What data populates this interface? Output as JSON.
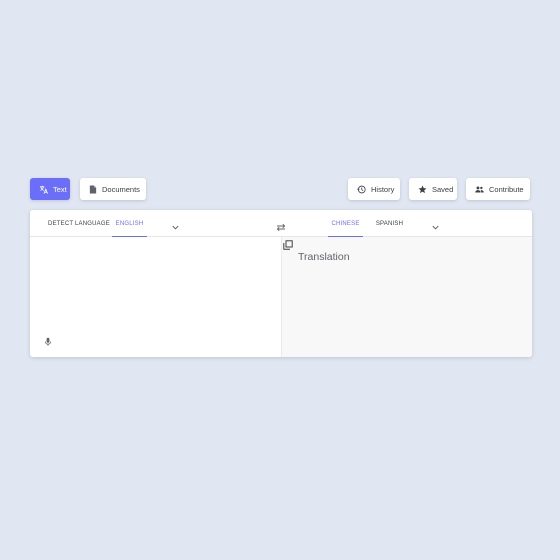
{
  "toolbar": {
    "text_label": "Text",
    "documents_label": "Documents",
    "history_label": "History",
    "saved_label": "Saved",
    "contribute_label": "Contribute"
  },
  "source": {
    "languages": [
      "DETECT LANGUAGE",
      "ENGLISH"
    ],
    "selected": "ENGLISH"
  },
  "target": {
    "languages": [
      "CHINESE",
      "SPANISH"
    ],
    "selected": "CHINESE",
    "placeholder": "Translation"
  },
  "colors": {
    "accent": "#6b6ef9",
    "background": "#e1e6f3",
    "output_pane": "#f8f8f9"
  },
  "icons": {
    "text": "translate-icon",
    "documents": "document-icon",
    "history": "history-icon",
    "saved": "star-icon",
    "contribute": "people-icon",
    "swap": "swap-icon",
    "copy": "copy-icon",
    "mic": "microphone-icon",
    "dropdown": "chevron-down-icon"
  }
}
